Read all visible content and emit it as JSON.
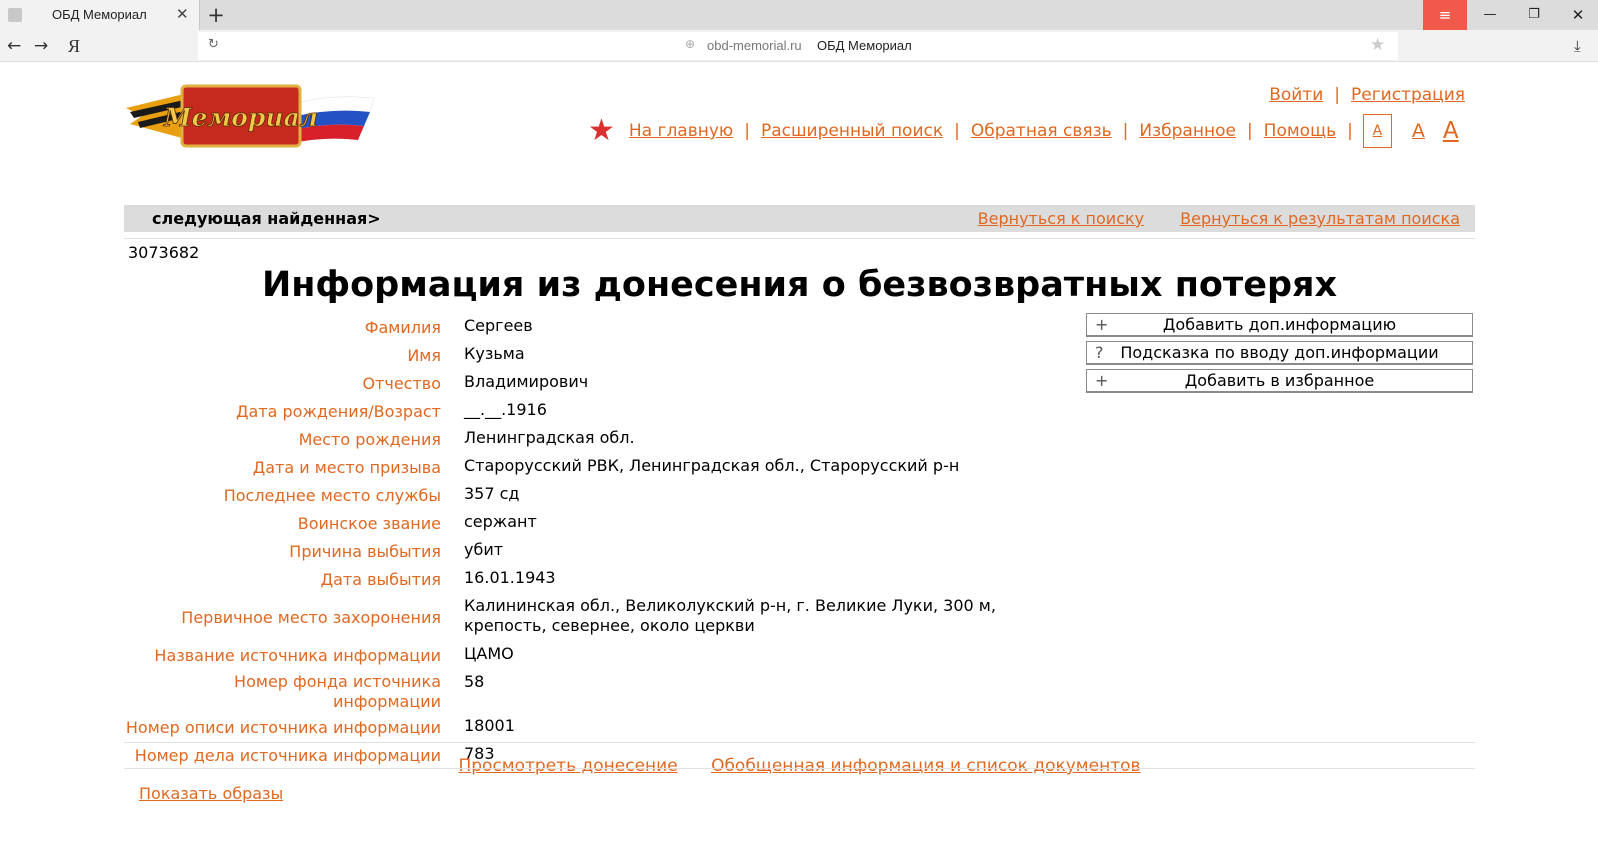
{
  "browser": {
    "tab_title": "ОБД Мемориал",
    "new_tab_symbol": "+",
    "close_symbol": "✕",
    "menu_symbol": "≡",
    "minimize_symbol": "—",
    "maximize_symbol": "❐",
    "window_close_symbol": "✕",
    "back_symbol": "←",
    "forward_symbol": "→",
    "yandex_logo": "Я",
    "reload_symbol": "↻",
    "globe_symbol": "⊕",
    "url_host": "obd-memorial.ru",
    "url_title": "ОБД Мемориал",
    "bookmark_symbol": "★",
    "download_symbol": "⤓"
  },
  "header": {
    "logo_text": "Мемориал",
    "login": "Войти",
    "register": "Регистрация",
    "separator": "|",
    "star_symbol": "★",
    "nav": [
      "На главную",
      "Расширенный поиск",
      "Обратная связь",
      "Избранное",
      "Помощь"
    ],
    "font_sizes": [
      "А",
      "А",
      "А"
    ]
  },
  "record_nav": {
    "next_found": "следующая найденная>",
    "back_to_search": "Вернуться к поиску",
    "back_to_results": "Вернуться к результатам поиска"
  },
  "record": {
    "id": "3073682",
    "title": "Информация из донесения о безвозвратных потерях",
    "fields": [
      {
        "label": "Фамилия",
        "value": "Сергеев"
      },
      {
        "label": "Имя",
        "value": "Кузьма"
      },
      {
        "label": "Отчество",
        "value": "Владимирович"
      },
      {
        "label": "Дата рождения/Возраст",
        "value": "__.__.1916"
      },
      {
        "label": "Место рождения",
        "value": "Ленинградская обл."
      },
      {
        "label": "Дата и место призыва",
        "value": "Старорусский РВК, Ленинградская обл., Старорусский р-н"
      },
      {
        "label": "Последнее место службы",
        "value": "357 сд"
      },
      {
        "label": "Воинское звание",
        "value": "сержант"
      },
      {
        "label": "Причина выбытия",
        "value": "убит"
      },
      {
        "label": "Дата выбытия",
        "value": "16.01.1943"
      },
      {
        "label": "Первичное место захоронения",
        "value": "Калининская обл., Великолукский р-н, г. Великие Луки, 300 м, крепость, севернее, около церкви"
      },
      {
        "label": "Название источника информации",
        "value": "ЦАМО"
      },
      {
        "label": "Номер фонда источника информации",
        "value": "58"
      },
      {
        "label": "Номер описи источника информации",
        "value": "18001"
      },
      {
        "label": "Номер дела источника информации",
        "value": "783"
      }
    ]
  },
  "actions": {
    "add_info": "Добавить доп.информацию",
    "add_info_icon": "+",
    "hint": "Подсказка по вводу доп.информации",
    "hint_icon": "?",
    "add_favorite": "Добавить в избранное",
    "add_favorite_icon": "+"
  },
  "bottom": {
    "view_report": "Просмотреть донесение",
    "summary": "Обобщенная информация и список документов",
    "show_images": "Показать образы"
  },
  "colors": {
    "accent_orange": "#e06820",
    "menu_red": "#f15a4a",
    "bar_gray": "#dcdcdc"
  }
}
